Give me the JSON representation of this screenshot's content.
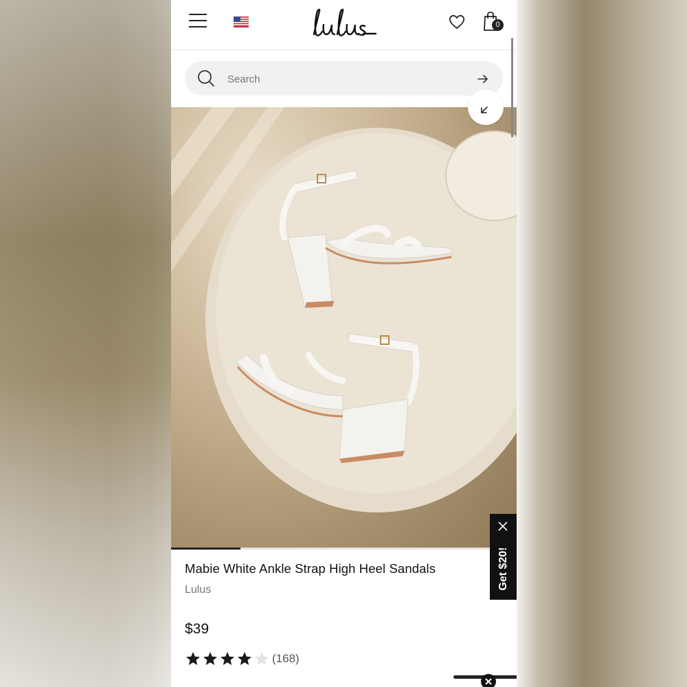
{
  "header": {
    "logo_text": "Lulus",
    "cart_count": "0",
    "icons": [
      "hamburger-menu-icon",
      "us-flag-icon",
      "heart-icon",
      "shopping-bag-icon"
    ]
  },
  "search": {
    "placeholder": "Search",
    "icons": [
      "search-icon",
      "arrow-right-icon"
    ]
  },
  "gallery": {
    "progress": 0.2,
    "icons": [
      "collapse-arrow-icon"
    ]
  },
  "product": {
    "title": "Mabie White Ankle Strap High Heel Sandals",
    "brand": "Lulus",
    "price": "$39",
    "rating": 4,
    "rating_max": 5,
    "review_count": "(168)"
  },
  "promo": {
    "label": "Get $20!",
    "icons": [
      "close-icon"
    ]
  },
  "colors": {
    "text": "#111111",
    "muted": "#777777",
    "search_bg": "#f1f1f1",
    "promo_bg": "#111111"
  }
}
